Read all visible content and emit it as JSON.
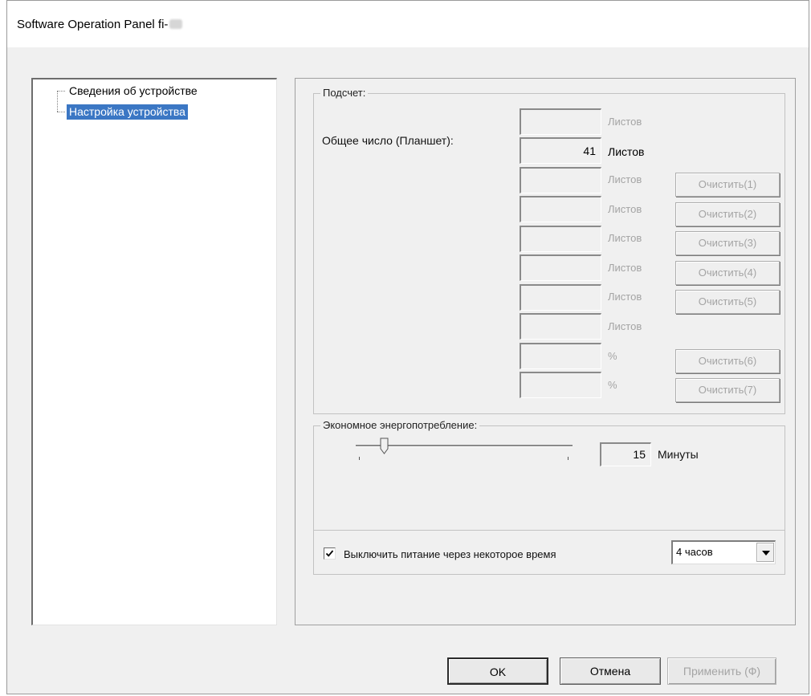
{
  "window": {
    "title": "Software Operation Panel fi-"
  },
  "tree": {
    "items": [
      {
        "label": "Сведения об устройстве",
        "selected": false
      },
      {
        "label": "Настройка устройства",
        "selected": true
      }
    ]
  },
  "count_group": {
    "title": "Подсчет:",
    "total_label": "Общее число (Планшет):",
    "rows": [
      {
        "value": "",
        "unit": "Листов",
        "button": "",
        "enabled": false
      },
      {
        "value": "41",
        "unit": "Листов",
        "button": "",
        "enabled": true
      },
      {
        "value": "",
        "unit": "Листов",
        "button": "Очистить(1)",
        "enabled": false
      },
      {
        "value": "",
        "unit": "Листов",
        "button": "Очистить(2)",
        "enabled": false
      },
      {
        "value": "",
        "unit": "Листов",
        "button": "Очистить(3)",
        "enabled": false
      },
      {
        "value": "",
        "unit": "Листов",
        "button": "Очистить(4)",
        "enabled": false
      },
      {
        "value": "",
        "unit": "Листов",
        "button": "Очистить(5)",
        "enabled": false
      },
      {
        "value": "",
        "unit": "Листов",
        "button": "",
        "enabled": false
      },
      {
        "value": "",
        "unit": "%",
        "button": "Очистить(6)",
        "enabled": false
      },
      {
        "value": "",
        "unit": "%",
        "button": "Очистить(7)",
        "enabled": false
      }
    ]
  },
  "power_group": {
    "title": "Экономное энергопотребление:",
    "slider_value": "15",
    "slider_unit": "Минуты",
    "auto_off_label": "Выключить питание через некоторое время",
    "auto_off_checked": true,
    "auto_off_selected": "4 часов"
  },
  "buttons": {
    "ok": "OK",
    "cancel": "Отмена",
    "apply": "Применить (Ф)"
  }
}
